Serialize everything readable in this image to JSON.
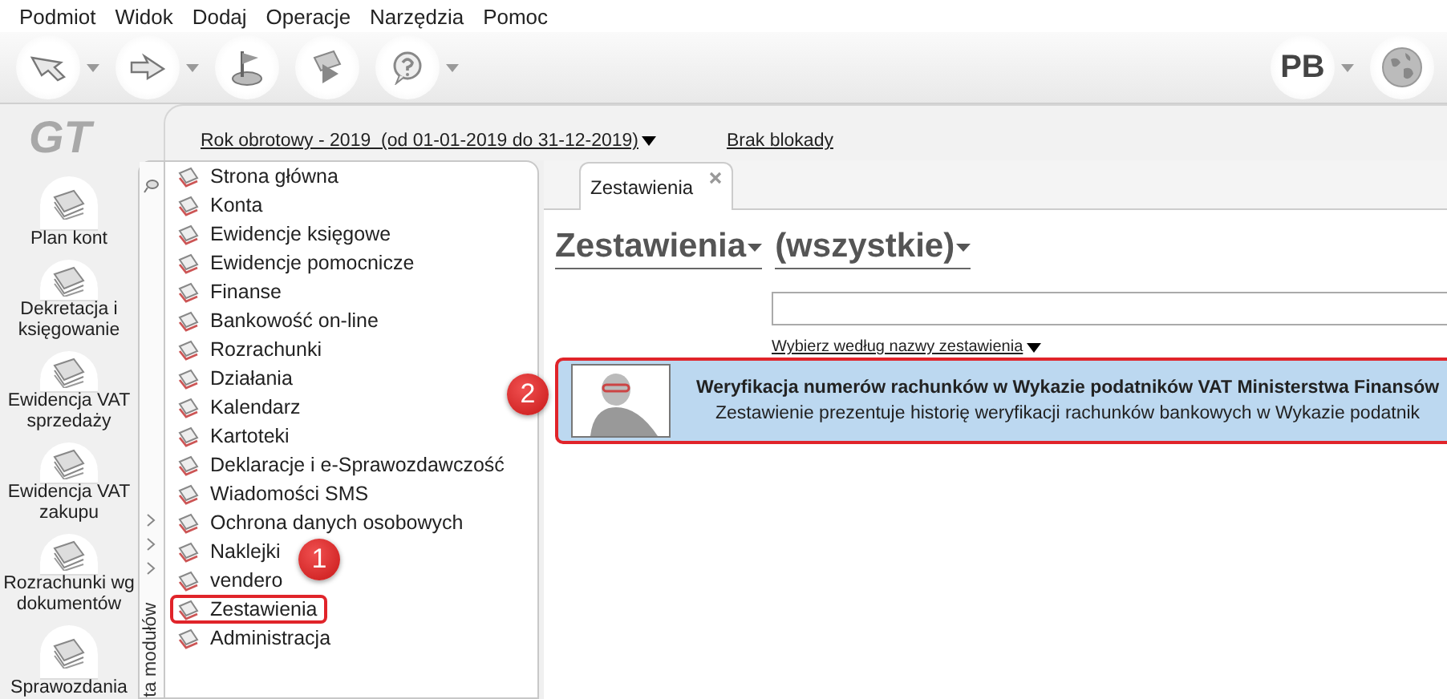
{
  "menu": [
    "Podmiot",
    "Widok",
    "Dodaj",
    "Operacje",
    "Narzędzia",
    "Pomoc"
  ],
  "toolbar": [
    {
      "kind": "back",
      "dropdown": true
    },
    {
      "kind": "forward",
      "dropdown": true
    },
    {
      "kind": "flag",
      "dropdown": false
    },
    {
      "kind": "run",
      "dropdown": false
    },
    {
      "kind": "help",
      "dropdown": true
    }
  ],
  "user": {
    "initials": "PB"
  },
  "logo": "GT",
  "nav": [
    "Plan kont",
    "Dekretacja i księgowanie",
    "Ewidencja VAT sprzedaży",
    "Ewidencja VAT zakupu",
    "Rozrachunki wg dokumentów",
    "Sprawozdania"
  ],
  "fiscal_year": "Rok obrotowy - 2019  (od 01-01-2019 do 31-12-2019)",
  "lock_status": "Brak blokady",
  "module_panel": {
    "caption": "ta modułów",
    "items": [
      {
        "label": "Strona główna",
        "highlighted": false
      },
      {
        "label": "Konta",
        "highlighted": false
      },
      {
        "label": "Ewidencje księgowe",
        "highlighted": false
      },
      {
        "label": "Ewidencje pomocnicze",
        "highlighted": false
      },
      {
        "label": "Finanse",
        "highlighted": false
      },
      {
        "label": "Bankowość on-line",
        "highlighted": false
      },
      {
        "label": "Rozrachunki",
        "highlighted": false
      },
      {
        "label": "Działania",
        "highlighted": false
      },
      {
        "label": "Kalendarz",
        "highlighted": false
      },
      {
        "label": "Kartoteki",
        "highlighted": false
      },
      {
        "label": "Deklaracje i e-Sprawozdawczość",
        "highlighted": false
      },
      {
        "label": "Wiadomości SMS",
        "highlighted": false
      },
      {
        "label": "Ochrona danych osobowych",
        "highlighted": false
      },
      {
        "label": "Naklejki",
        "highlighted": false
      },
      {
        "label": "vendero",
        "highlighted": false
      },
      {
        "label": "Zestawienia",
        "highlighted": true
      },
      {
        "label": "Administracja",
        "highlighted": false
      }
    ]
  },
  "tabs": [
    {
      "label": "Zestawienia",
      "selected": true
    }
  ],
  "heading": {
    "category": "Zestawienia",
    "filter": "(wszystkie)"
  },
  "sort_link": "Wybierz według nazwy zestawienia",
  "reports": [
    {
      "title": "Weryfikacja numerów rachunków w Wykazie podatników VAT Ministerstwa Finansów",
      "description": "Zestawienie prezentuje historię weryfikacji rachunków bankowych w Wykazie podatnik",
      "highlighted": true
    }
  ],
  "callouts": [
    "1",
    "2"
  ]
}
